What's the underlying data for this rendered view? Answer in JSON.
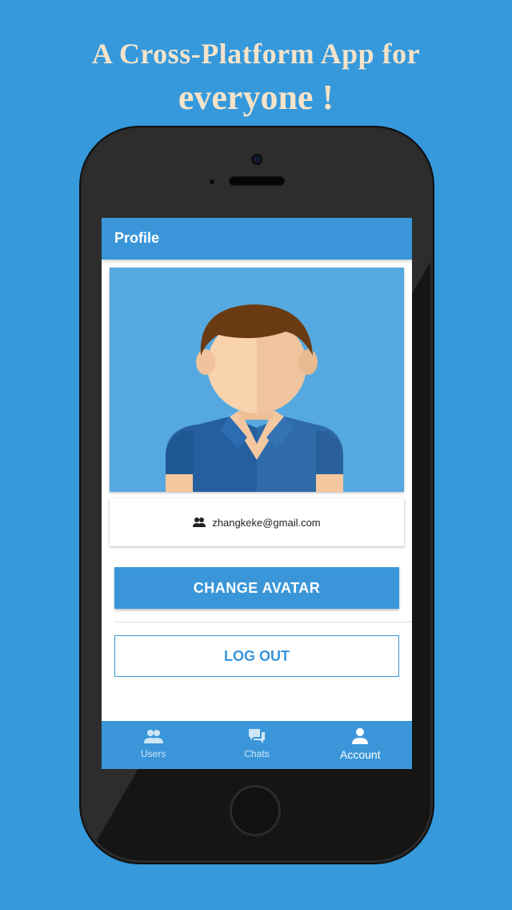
{
  "promo": {
    "line1": "A Cross-Platform App for",
    "line2": "everyone !"
  },
  "app": {
    "title": "Profile",
    "email": "zhangkeke@gmail.com",
    "change_avatar_label": "CHANGE AVATAR",
    "logout_label": "LOG OUT"
  },
  "tabs": [
    {
      "label": "Users",
      "icon": "users-icon",
      "active": false
    },
    {
      "label": "Chats",
      "icon": "chat-icon",
      "active": false
    },
    {
      "label": "Account",
      "icon": "account-icon",
      "active": true
    }
  ],
  "colors": {
    "background": "#3599dc",
    "primary": "#3a96d9",
    "headline": "#f6e3c9"
  }
}
